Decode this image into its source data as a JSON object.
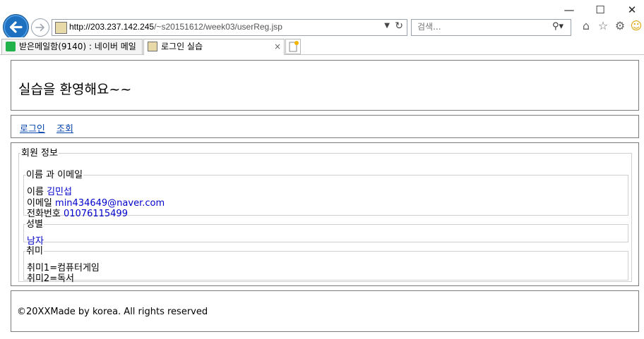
{
  "browser": {
    "url_domain": "http://203.237.142.245",
    "url_path": "/~s20151612/week03/userReg.jsp",
    "search_placeholder": "검색...",
    "tabs": [
      {
        "label": "받은메일함(9140) : 네이버 메일",
        "active": false
      },
      {
        "label": "로그인 실습",
        "active": true
      }
    ],
    "tab_close_glyph": "×",
    "window_controls": [
      "minimize-icon",
      "maximize-icon",
      "close-icon"
    ],
    "accent_color": "#1d6fc0"
  },
  "header": {
    "title": "실습을 환영해요~~"
  },
  "nav": {
    "links": [
      "로그인",
      "조회"
    ]
  },
  "member": {
    "legend": "회원 정보",
    "name_email": {
      "legend": "이름 과 이메일",
      "name_label": "이름",
      "name_value": "김민섭",
      "email_label": "이메일",
      "email_value": "min434649@naver.com",
      "phone_label": "전화번호",
      "phone_value": "01076115499"
    },
    "gender": {
      "legend": "성별",
      "value": "남자"
    },
    "hobby": {
      "legend": "취미",
      "items": [
        "취미1=컴퓨터게임",
        "취미2=독서"
      ]
    }
  },
  "footer": {
    "text": "©20XXMade by korea. All rights reserved"
  },
  "colors": {
    "value_text": "#0000cc",
    "link": "#0645ad",
    "border": "#7a7a7a"
  }
}
